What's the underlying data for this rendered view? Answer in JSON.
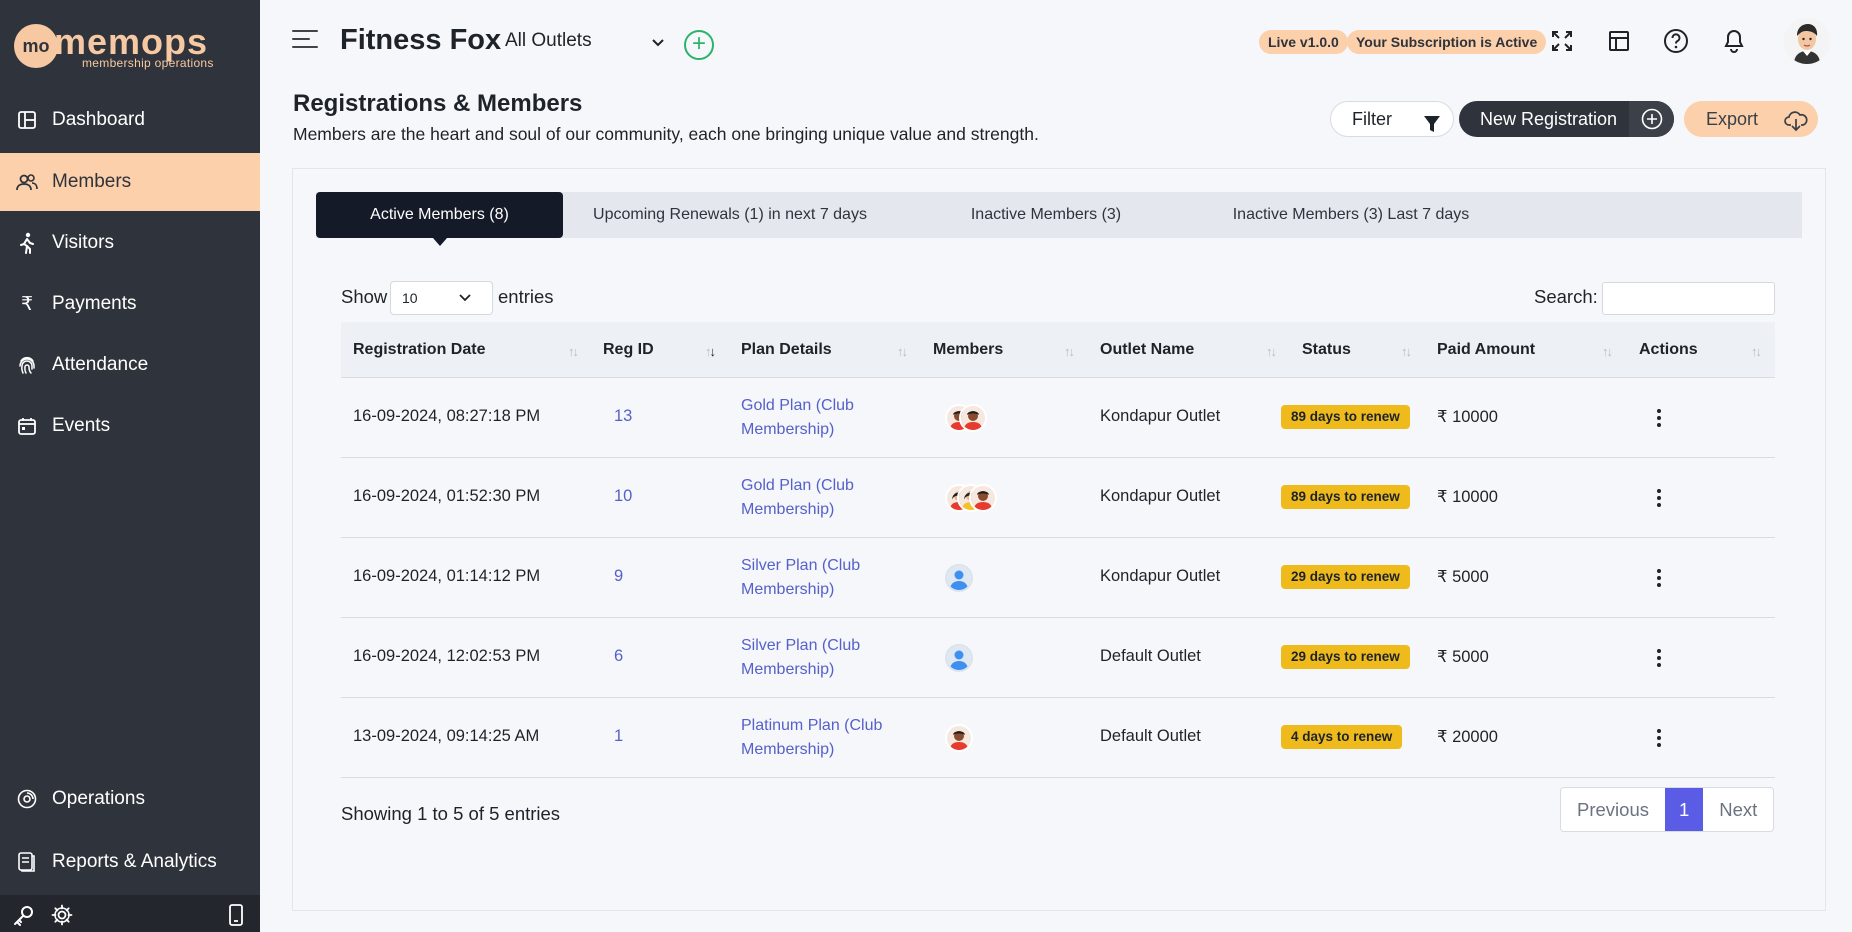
{
  "sidebar": {
    "logo": {
      "circle": "mo",
      "word": "memops",
      "tagline": "membership operations"
    },
    "items": [
      {
        "label": "Dashboard",
        "icon": "dashboard-icon"
      },
      {
        "label": "Members",
        "icon": "users-icon",
        "active": true
      },
      {
        "label": "Visitors",
        "icon": "walking-icon"
      },
      {
        "label": "Payments",
        "icon": "rupee-icon"
      },
      {
        "label": "Attendance",
        "icon": "fingerprint-icon"
      },
      {
        "label": "Events",
        "icon": "calendar-icon"
      }
    ],
    "bottom_items": [
      {
        "label": "Operations",
        "icon": "operations-icon"
      },
      {
        "label": "Reports & Analytics",
        "icon": "reports-icon"
      }
    ],
    "footer_icons": [
      "key-icon",
      "gear-icon",
      "mobile-icon"
    ]
  },
  "header": {
    "brand": "Fitness Fox",
    "outlet": "All Outlets",
    "version_badge": "Live v1.0.0",
    "subscription_badge": "Your Subscription is Active"
  },
  "page": {
    "title": "Registrations & Members",
    "subtitle": "Members are the heart and soul of our community, each one bringing unique value and strength.",
    "filter_label": "Filter",
    "new_registration_label": "New Registration",
    "export_label": "Export"
  },
  "tabs": [
    {
      "label": "Active Members (8)",
      "active": true
    },
    {
      "label": "Upcoming Renewals (1) in next 7 days"
    },
    {
      "label": "Inactive Members (3)"
    },
    {
      "label": "Inactive Members (3) Last 7 days"
    }
  ],
  "controls": {
    "show_label": "Show",
    "page_size": "10",
    "entries_label": "entries",
    "search_label": "Search:",
    "search_value": ""
  },
  "table": {
    "columns": [
      "Registration Date",
      "Reg ID",
      "Plan Details",
      "Members",
      "Outlet Name",
      "Status",
      "Paid Amount",
      "Actions"
    ],
    "rows": [
      {
        "date": "16-09-2024, 08:27:18 PM",
        "reg_id": "13",
        "plan": "Gold Plan (Club Membership)",
        "outlet": "Kondapur Outlet",
        "status": "89 days to renew",
        "amount": "₹ 10000",
        "members": [
          "male-avatar",
          "male-avatar"
        ]
      },
      {
        "date": "16-09-2024, 01:52:30 PM",
        "reg_id": "10",
        "plan": "Gold Plan (Club Membership)",
        "outlet": "Kondapur Outlet",
        "status": "89 days to renew",
        "amount": "₹ 10000",
        "members": [
          "female-avatar",
          "female-avatar",
          "male-avatar"
        ]
      },
      {
        "date": "16-09-2024, 01:14:12 PM",
        "reg_id": "9",
        "plan": "Silver Plan (Club Membership)",
        "outlet": "Kondapur Outlet",
        "status": "29 days to renew",
        "amount": "₹ 5000",
        "members": [
          "default-avatar"
        ]
      },
      {
        "date": "16-09-2024, 12:02:53 PM",
        "reg_id": "6",
        "plan": "Silver Plan (Club Membership)",
        "outlet": "Default Outlet",
        "status": "29 days to renew",
        "amount": "₹ 5000",
        "members": [
          "default-avatar"
        ]
      },
      {
        "date": "13-09-2024, 09:14:25 AM",
        "reg_id": "1",
        "plan": "Platinum Plan (Club Membership)",
        "outlet": "Default Outlet",
        "status": "4 days to renew",
        "amount": "₹ 20000",
        "members": [
          "male-avatar"
        ]
      }
    ]
  },
  "footer": {
    "info": "Showing 1 to 5 of 5 entries",
    "previous": "Previous",
    "current_page": "1",
    "next": "Next"
  },
  "colors": {
    "sidebar_bg": "#2f333b",
    "accent_peach": "#fbd0ab",
    "status_yellow": "#efbb1c",
    "link_blue": "#5561c8",
    "active_tab": "#141a28",
    "page_button": "#5a5ce6"
  }
}
